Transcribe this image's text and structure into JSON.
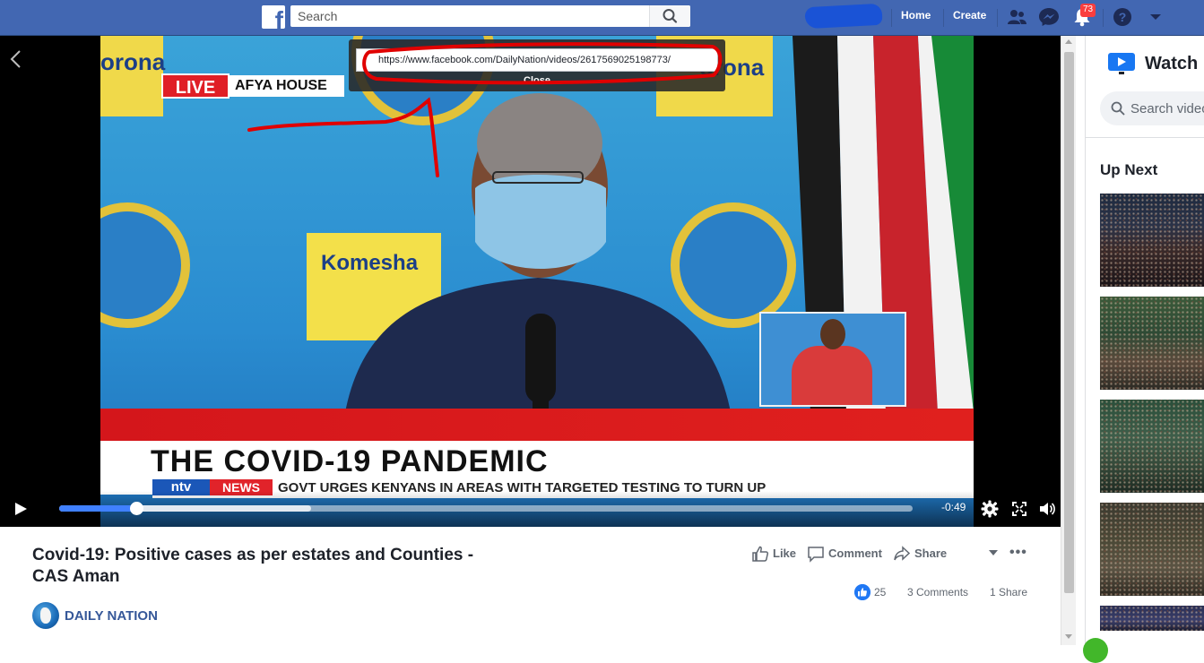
{
  "topbar": {
    "search_placeholder": "Search",
    "nav_home": "Home",
    "nav_create": "Create",
    "notification_count": "73",
    "icons": [
      "facebook-logo",
      "search-icon",
      "friends-icon",
      "messenger-icon",
      "notifications-icon",
      "help-icon",
      "caret-down-icon"
    ],
    "bar_color": "#4267b2"
  },
  "video": {
    "url": "https://www.facebook.com/DailyNation/videos/2617569025198773/",
    "close_label": "Close",
    "live_label": "LIVE",
    "location_label": "AFYA HOUSE",
    "banner_text_top_left": "orona",
    "banner_text_top_right": "orona",
    "banner_text_middle": "Komesha",
    "headline": "THE COVID-19 PANDEMIC",
    "channel_label": "ntv",
    "news_label": "NEWS",
    "ticker": "GOVT URGES KENYANS IN AREAS WITH TARGETED TESTING TO TURN UP",
    "time_remaining": "-0:49",
    "progress_played_fraction": 0.09,
    "progress_buffered_fraction": 0.295,
    "accent": "#4080ff",
    "annotation_color": "#e00000"
  },
  "post": {
    "title": "Covid-19: Positive cases as per estates and Counties - CAS Aman",
    "like_label": "Like",
    "comment_label": "Comment",
    "share_label": "Share",
    "like_count": "25",
    "comments_count": "3 Comments",
    "shares_count": "1 Share",
    "page_name": "DAILY NATION"
  },
  "sidebar": {
    "title": "Watch",
    "search_placeholder": "Search videos",
    "up_next_label": "Up Next"
  }
}
